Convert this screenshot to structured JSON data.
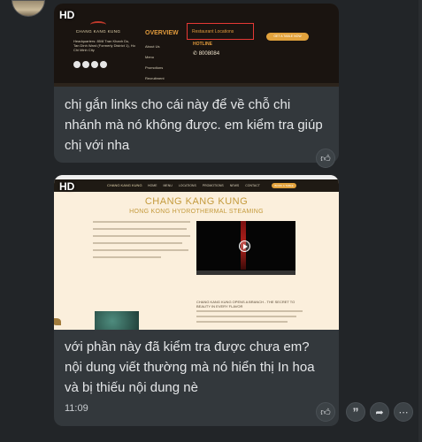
{
  "messages": [
    {
      "hd_badge": "HD",
      "screenshot": {
        "brand": "CHANG KANG KUNG",
        "address": "Headquarters: 85/8 Tran Khanh Du, Tan Dinh Ward (Formerly District 1), Ho Chi Minh City",
        "overview_title": "OVERVIEW",
        "overview_links": [
          "About Us",
          "Menu",
          "Promotions",
          "Recruitment"
        ],
        "highlighted_link": "Restaurant Locations",
        "hotline_label": "HOTLINE",
        "hotline_number": "8008084",
        "cta_label": "GET A TABLE NOW"
      },
      "text": "chị gắn links cho cái này để về chỗ chi nhánh mà nó không được. em kiểm tra giúp chị với nha"
    },
    {
      "hd_badge": "HD",
      "screenshot": {
        "nav_brand": "CHANG KANG KUNG",
        "nav_items": [
          "HOME",
          "MENU",
          "LOCATIONS",
          "PROMOTIONS",
          "NEWS",
          "CONTACT"
        ],
        "nav_button": "BOOK A TABLE",
        "title": "CHANG KANG KUNG",
        "subtitle": "HONG KONG HYDROTHERMAL STEAMING",
        "section_heading": "CHANG KANG KUNG OPENS A BRANCH - THE SECRET TO BEAUTY IN EVERY FLAVOR"
      },
      "text": "với phần này đã kiểm tra được chưa em? nội dung viết thường mà nó hiển thị In hoa và bị thiếu nội dung nè",
      "timestamp": "11:09"
    }
  ],
  "icons": {
    "like": "thumbs-up-icon",
    "quote": "quote-icon",
    "forward": "forward-icon",
    "more": "more-icon"
  }
}
